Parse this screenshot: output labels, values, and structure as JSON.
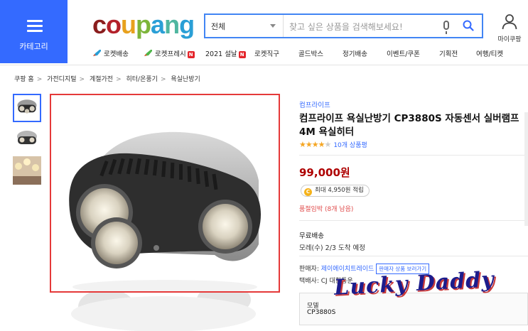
{
  "header": {
    "category_label": "카테고리",
    "logo_text": [
      "c",
      "o",
      "u",
      "p",
      "a",
      "n",
      "g"
    ],
    "search": {
      "category": "전체",
      "placeholder": "찾고 싶은 상품을 검색해보세요!"
    },
    "mycoupang_label": "마이쿠팡"
  },
  "nav": {
    "items": [
      {
        "label": "로켓배송",
        "icon": "rocket-icon"
      },
      {
        "label": "로켓프레시",
        "icon": "rocket-fresh-icon",
        "badge": "N"
      },
      {
        "label": "2021 설날",
        "badge": "N"
      },
      {
        "label": "로켓직구"
      },
      {
        "label": "골드박스"
      },
      {
        "label": "정기배송"
      },
      {
        "label": "이벤트/쿠폰"
      },
      {
        "label": "기획전"
      },
      {
        "label": "여행/티켓"
      }
    ]
  },
  "breadcrumb": [
    "쿠팡 홈",
    "가전디지털",
    "계절가전",
    "히터/온풍기",
    "욕실난방기"
  ],
  "breadcrumb_sep": ">",
  "product": {
    "brand": "컴프라이프",
    "title": "컴프라이프 욕실난방기 CP3880S 자동센서 실버램프4M 욕실히터",
    "rating_stars": 4,
    "review_count": "10개 상품평",
    "price": "99,000원",
    "reward": "최대 4,950원 적립",
    "reward_coin": "C",
    "stock_text": "품절임박 (8개 남음)",
    "shipping_title": "무료배송",
    "shipping_date": "모레(수) 2/3 도착 예정",
    "seller_label": "판매자:",
    "seller_name": "제이에이치트레이드",
    "seller_button": "판매자 상품 보러가기",
    "courier_text": "택배사: CJ 대한통운",
    "model_label": "모델",
    "model_value": "CP3880S"
  },
  "watermark": "Lucky Daddy",
  "colors": {
    "accent": "#346aff",
    "price": "#ae0000",
    "stock": "#e04c4c",
    "image_border": "#e53939",
    "star": "#f5a623"
  }
}
